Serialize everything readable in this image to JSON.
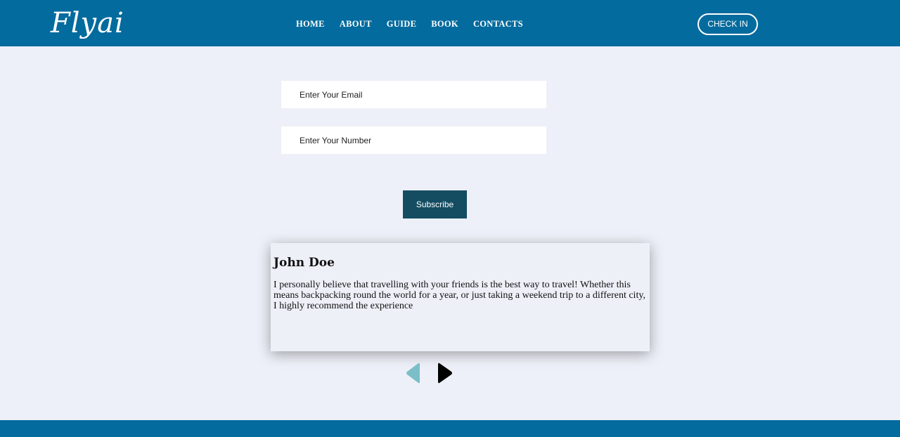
{
  "brand": {
    "logo_text": "Flyai"
  },
  "nav": {
    "items": [
      {
        "label": "HOME"
      },
      {
        "label": "ABOUT"
      },
      {
        "label": "GUIDE"
      },
      {
        "label": "BOOK"
      },
      {
        "label": "CONTACTS"
      }
    ],
    "check_in_label": "CHECK IN"
  },
  "form": {
    "email_placeholder": "Enter Your Email",
    "number_placeholder": "Enter Your Number",
    "subscribe_label": "Subscribe"
  },
  "testimonial": {
    "name": "John Doe",
    "text": "I personally believe that travelling with your friends is the best way to travel! Whether this means backpacking round the world for a year, or just taking a weekend trip to a different city, I highly recommend the experience"
  },
  "carousel": {
    "prev_icon": "triangle-left-icon",
    "next_icon": "triangle-right-icon"
  },
  "colors": {
    "header": "#046b9e",
    "background": "#edf0f8",
    "button": "#144d62",
    "arrow_prev": "#7bbec8",
    "arrow_next": "#000000"
  }
}
